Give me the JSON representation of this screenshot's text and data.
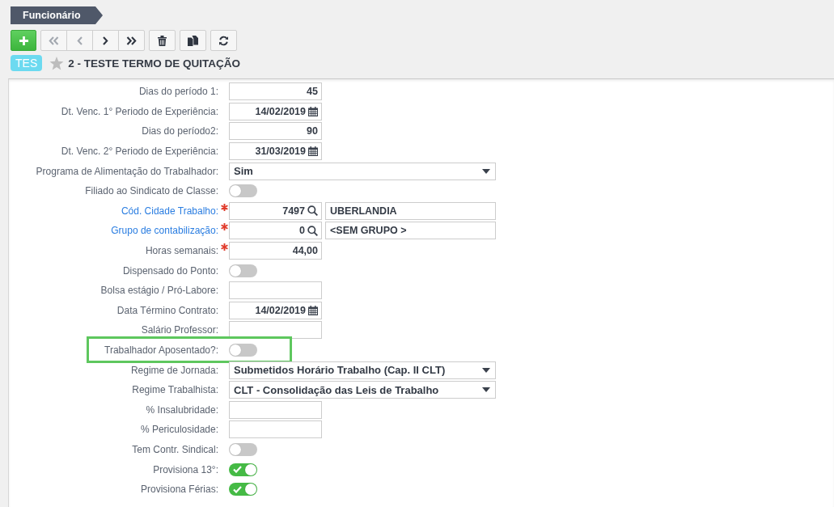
{
  "header": {
    "title": "Funcionário"
  },
  "toolbar": {
    "groups": [
      [
        {
          "kind": "add",
          "disabled": false
        }
      ],
      [
        {
          "kind": "first",
          "disabled": true
        },
        {
          "kind": "previous",
          "disabled": true
        },
        {
          "kind": "next",
          "disabled": false
        },
        {
          "kind": "last",
          "disabled": false
        }
      ],
      [
        {
          "kind": "delete",
          "disabled": false
        }
      ],
      [
        {
          "kind": "copy",
          "disabled": false
        }
      ],
      [
        {
          "kind": "refresh",
          "disabled": false
        }
      ]
    ]
  },
  "record": {
    "code_badge": "TES",
    "favorite": false,
    "title": "2 - TESTE TERMO DE QUITAÇÃO"
  },
  "fields": [
    {
      "kind": "number",
      "label": "Dias do período 1:",
      "link": false,
      "required": false,
      "highlighted": false,
      "value": "45"
    },
    {
      "kind": "date",
      "label": "Dt. Venc. 1° Periodo de Experiência:",
      "link": false,
      "required": false,
      "highlighted": false,
      "value": "14/02/2019"
    },
    {
      "kind": "number",
      "label": "Dias do período2:",
      "link": false,
      "required": false,
      "highlighted": false,
      "value": "90"
    },
    {
      "kind": "date",
      "label": "Dt. Venc. 2° Periodo de Experiência:",
      "link": false,
      "required": false,
      "highlighted": false,
      "value": "31/03/2019"
    },
    {
      "kind": "select",
      "label": "Programa de Alimentação do Trabalhador:",
      "link": false,
      "required": false,
      "highlighted": false,
      "value": "Sim"
    },
    {
      "kind": "toggle",
      "label": "Filiado ao Sindicato de Classe:",
      "link": false,
      "required": false,
      "highlighted": false,
      "on": false
    },
    {
      "kind": "lookup",
      "label": "Cód. Cidade Trabalho:",
      "link": true,
      "required": true,
      "highlighted": false,
      "value": "7497",
      "description": "UBERLANDIA"
    },
    {
      "kind": "lookup",
      "label": "Grupo de contabilização:",
      "link": true,
      "required": true,
      "highlighted": false,
      "value": "0",
      "description": "<SEM GRUPO >"
    },
    {
      "kind": "number",
      "label": "Horas semanais:",
      "link": false,
      "required": true,
      "highlighted": false,
      "value": "44,00"
    },
    {
      "kind": "toggle",
      "label": "Dispensado do Ponto:",
      "link": false,
      "required": false,
      "highlighted": false,
      "on": false
    },
    {
      "kind": "text",
      "label": "Bolsa estágio / Pró-Labore:",
      "link": false,
      "required": false,
      "highlighted": false
    },
    {
      "kind": "date",
      "label": "Data Término Contrato:",
      "link": false,
      "required": false,
      "highlighted": false,
      "value": "14/02/2019"
    },
    {
      "kind": "text",
      "label": "Salário Professor:",
      "link": false,
      "required": false,
      "highlighted": false
    },
    {
      "kind": "toggle",
      "label": "Trabalhador Aposentado?:",
      "link": false,
      "required": false,
      "highlighted": true,
      "on": false
    },
    {
      "kind": "select",
      "label": "Regime de Jornada:",
      "link": false,
      "required": false,
      "highlighted": false,
      "value": "Submetidos Horário Trabalho (Cap. II CLT)"
    },
    {
      "kind": "select",
      "label": "Regime Trabalhista:",
      "link": false,
      "required": false,
      "highlighted": false,
      "value": "CLT - Consolidação das Leis de Trabalho"
    },
    {
      "kind": "text",
      "label": "% Insalubridade:",
      "link": false,
      "required": false,
      "highlighted": false
    },
    {
      "kind": "text",
      "label": "% Periculosidade:",
      "link": false,
      "required": false,
      "highlighted": false
    },
    {
      "kind": "toggle",
      "label": "Tem Contr. Sindical:",
      "link": false,
      "required": false,
      "highlighted": false,
      "on": false
    },
    {
      "kind": "toggle",
      "label": "Provisiona 13°:",
      "link": false,
      "required": false,
      "highlighted": false,
      "on": true
    },
    {
      "kind": "toggle",
      "label": "Provisiona Férias:",
      "link": false,
      "required": false,
      "highlighted": false,
      "on": true
    }
  ]
}
